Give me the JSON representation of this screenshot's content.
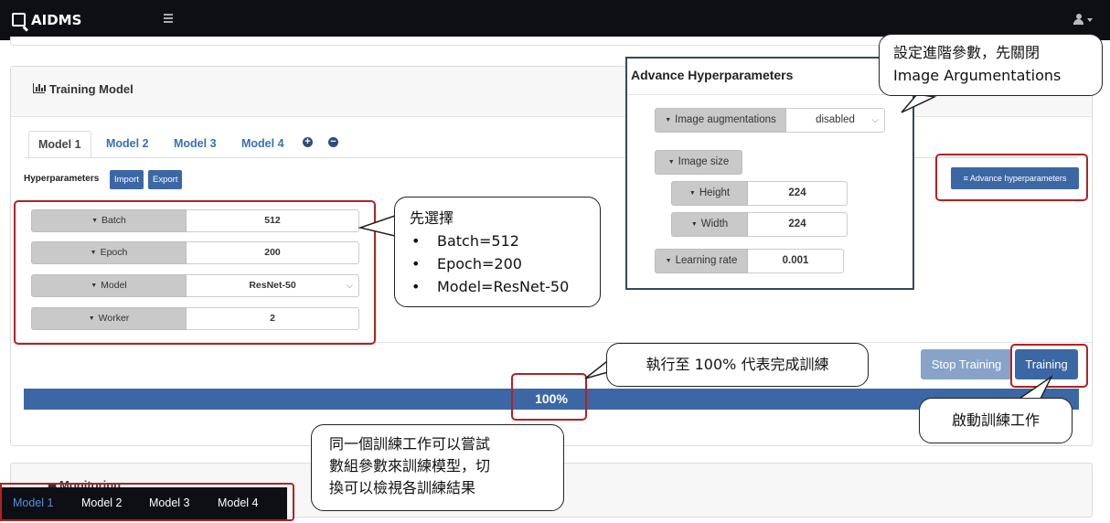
{
  "navbar": {
    "app_name": "AIDMS",
    "logo_icon": "logo-icon",
    "menu_icon": "hamburger-icon",
    "user_icon": "user-icon"
  },
  "card": {
    "title": "Training Model",
    "title_icon": "bar-chart-icon",
    "tabs": [
      "Model 1",
      "Model 2",
      "Model 3",
      "Model 4"
    ],
    "active_tab": "Model 1",
    "add_icon": "plus-circle-icon",
    "remove_icon": "minus-circle-icon",
    "hyperparameters_label": "Hyperparameters",
    "import_label": "Import",
    "export_label": "Export",
    "advance_button": "Advance hyperparameters",
    "advance_button_icon": "list-icon",
    "rows": [
      {
        "label": "Batch",
        "value": "512"
      },
      {
        "label": "Epoch",
        "value": "200"
      },
      {
        "label": "Model",
        "value": "ResNet-50"
      },
      {
        "label": "Worker",
        "value": "2"
      }
    ],
    "stop_label": "Stop Training",
    "train_label": "Training",
    "progress_percent": 100,
    "progress_text": "100%"
  },
  "advanced": {
    "title": "Advance Hyperparameters",
    "augment_label": "Image augmentations",
    "augment_value": "disabled",
    "size_label": "Image size",
    "height_label": "Height",
    "height_value": "224",
    "width_label": "Width",
    "width_value": "224",
    "lr_label": "Learning rate",
    "lr_value": "0.001"
  },
  "monitoring": {
    "title": "Monitoring"
  },
  "bottom_bar": {
    "items": [
      "Model 1",
      "Model 2",
      "Model 3",
      "Model 4"
    ],
    "active": "Model 1"
  },
  "callouts": {
    "select_title": "先選擇",
    "select_items": [
      "Batch=512",
      "Epoch=200",
      "Model=ResNet-50"
    ],
    "advanced_line1": "設定進階參數，先關閉",
    "advanced_line2": "Image Argumentations",
    "progress_note": "執行至 100% 代表完成訓練",
    "start_note": "啟動訓練工作",
    "models_line1": "同一個訓練工作可以嘗試",
    "models_line2": "數組參數來訓練模型，切",
    "models_line3": "換可以檢視各訓練結果"
  },
  "colors": {
    "navbar": "#0d0f14",
    "primary": "#3c67a5",
    "stop": "#87a3c8",
    "highlight": "#b22222",
    "tab_link": "#3a6fb0"
  }
}
